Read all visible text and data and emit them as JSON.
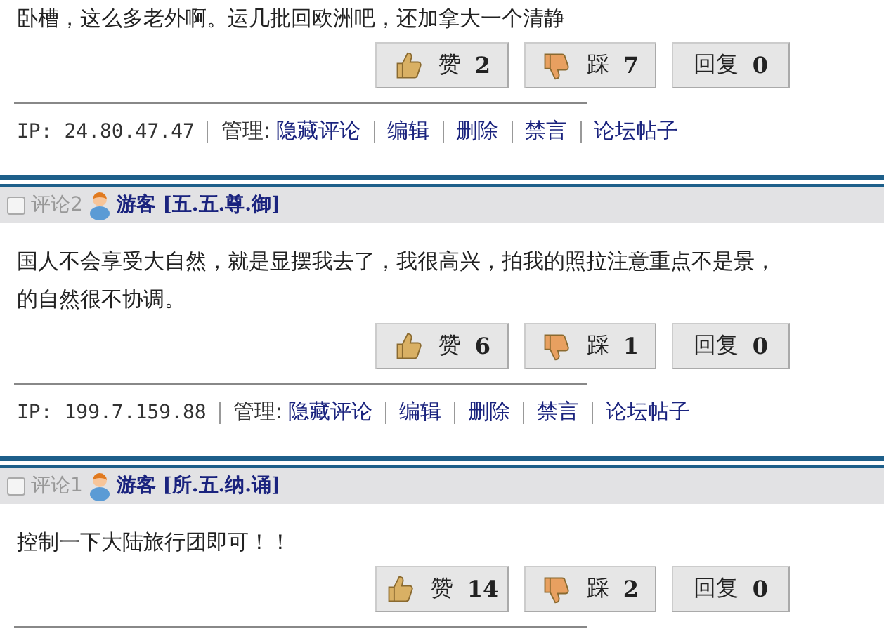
{
  "comments": [
    {
      "lines": [
        "卧槽，这么多老外啊。运几批回欧洲吧，还加拿大一个清静"
      ],
      "buttons": [
        {
          "kind": "like",
          "label": "赞",
          "count": "2"
        },
        {
          "kind": "dislike",
          "label": "踩",
          "count": "7"
        },
        {
          "kind": "reply",
          "label": "回复",
          "count": "0"
        }
      ],
      "ip": "IP: 24.80.47.47",
      "admin_label": "管理:",
      "admin_links": [
        "隐藏评论",
        "编辑",
        "删除",
        "禁言",
        "论坛帖子"
      ]
    },
    {
      "header": {
        "checked": false,
        "label": "评论2",
        "author": "游客 [五.五.尊.御]"
      },
      "lines": [
        "国人不会享受大自然，就是显摆我去了，我很高兴，拍我的照拉注意重点不是景，",
        "的自然很不协调。"
      ],
      "buttons": [
        {
          "kind": "like",
          "label": "赞",
          "count": "6"
        },
        {
          "kind": "dislike",
          "label": "踩",
          "count": "1"
        },
        {
          "kind": "reply",
          "label": "回复",
          "count": "0"
        }
      ],
      "ip": "IP: 199.7.159.88",
      "admin_label": "管理:",
      "admin_links": [
        "隐藏评论",
        "编辑",
        "删除",
        "禁言",
        "论坛帖子"
      ]
    },
    {
      "header": {
        "checked": false,
        "label": "评论1",
        "author": "游客 [所.五.纳.诵]"
      },
      "lines": [
        "控制一下大陆旅行团即可！！"
      ],
      "buttons": [
        {
          "kind": "like",
          "label": "赞",
          "count": "14"
        },
        {
          "kind": "dislike",
          "label": "踩",
          "count": "2"
        },
        {
          "kind": "reply",
          "label": "回复",
          "count": "0"
        }
      ]
    }
  ]
}
